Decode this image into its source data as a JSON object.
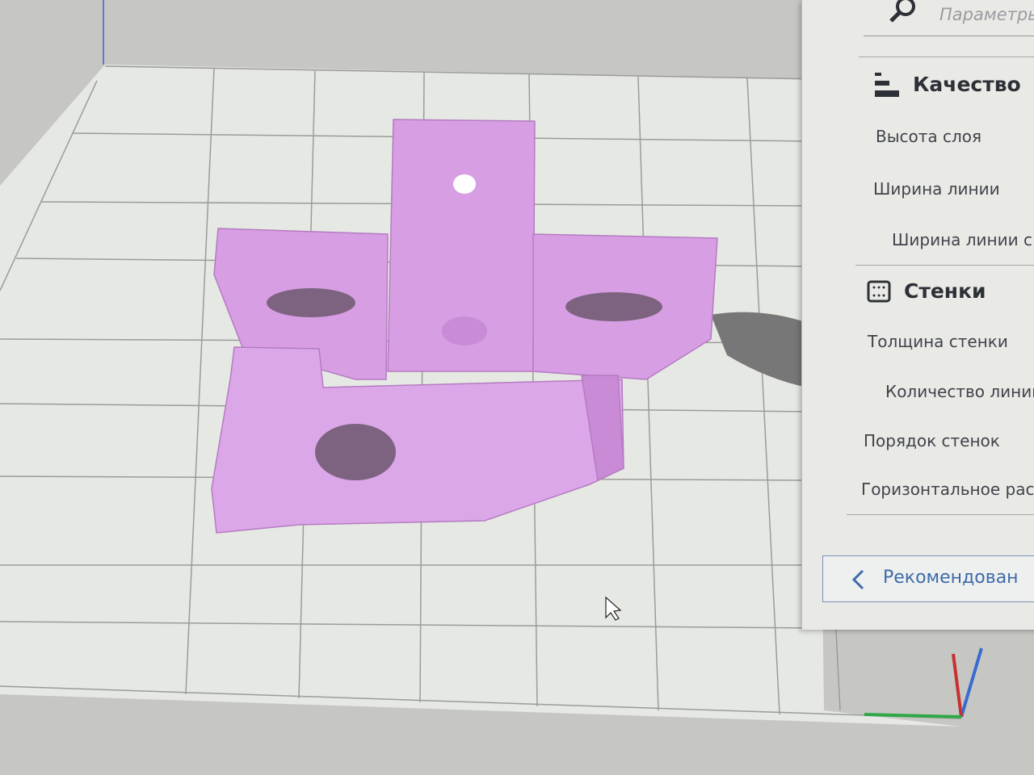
{
  "settings_panel": {
    "search_placeholder": "Параметры",
    "categories": [
      {
        "title": "Качество",
        "icon": "quality-icon",
        "settings": [
          "Высота слоя",
          "Ширина линии",
          "Ширина линии с"
        ]
      },
      {
        "title": "Стенки",
        "icon": "walls-icon",
        "settings": [
          "Толщина стенки",
          "Количество линий",
          "Порядок стенок",
          "Горизонтальное расш"
        ]
      }
    ],
    "recommended_button": "Рекомендован"
  },
  "colors": {
    "model": "#d79ee3",
    "plate": "#e9ebe7",
    "grid": "#8d8f8c",
    "accent": "#3e6aa8"
  }
}
